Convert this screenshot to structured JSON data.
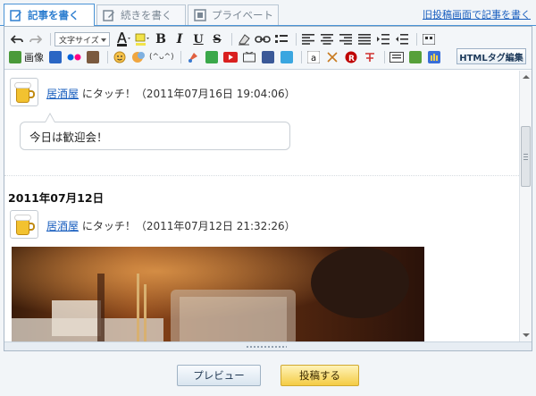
{
  "tabs": [
    {
      "label": "記事を書く",
      "icon": "pencil-icon",
      "active": true
    },
    {
      "label": "続きを書く",
      "icon": "edit-continue-icon",
      "active": false
    },
    {
      "label": "プライベート",
      "icon": "private-icon",
      "active": false
    }
  ],
  "old_screen_link": "旧投稿画面で記事を書く",
  "toolbar": {
    "font_size_label": "文字サイズ",
    "bold": "B",
    "italic": "I",
    "underline": "U",
    "strike": "S",
    "image_label": "画像",
    "html_button": "HTMLタグ編集"
  },
  "posts": [
    {
      "place": "居酒屋",
      "touch_text": "にタッチ！（2011年07月16日 19:04:06）",
      "bubble": "今日は歓迎会！"
    },
    {
      "date_heading": "2011年07月12日",
      "place": "居酒屋",
      "touch_text": "にタッチ！（2011年07月12日 21:32:26）"
    }
  ],
  "buttons": {
    "preview": "プレビュー",
    "post": "投稿する"
  },
  "colors": {
    "accent_blue": "#2f7fd0",
    "link_blue": "#1a5fbf",
    "post_button_yellow": "#f4cc45"
  }
}
